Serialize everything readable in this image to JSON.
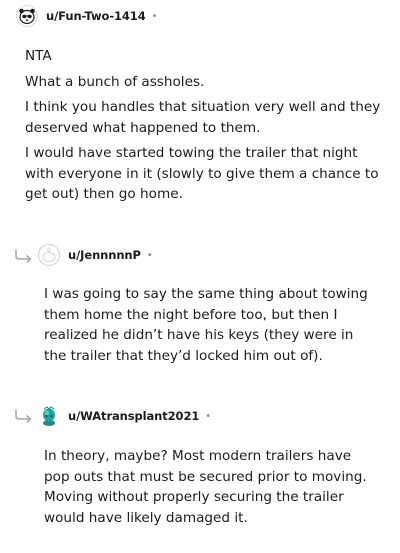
{
  "comments": [
    {
      "username": "u/Fun-Two-1414",
      "separator": "•",
      "avatar_icon": "panda-avatar-icon",
      "paragraphs": [
        "NTA",
        "What a bunch of assholes.",
        "I think you handles that situation very well and they deserved what happened to them.",
        "I would have started towing the trailer that night with everyone in it (slowly to give them a chance to get out) then go home."
      ]
    },
    {
      "username": "u/JennnnnP",
      "separator": "•",
      "avatar_icon": "default-snoo-avatar-icon",
      "reply_icon": "reply-arrow-icon",
      "paragraphs": [
        "I was going to say the same thing about towing them home the night before too, but then I realized he didn’t have his keys (they were in the trailer that they’d locked him out of)."
      ]
    },
    {
      "username": "u/WAtransplant2021",
      "separator": "•",
      "avatar_icon": "teal-snoo-avatar-icon",
      "reply_icon": "reply-arrow-icon",
      "paragraphs": [
        "In theory, maybe? Most modern trailers have pop outs that must be secured prior to moving. Moving without properly securing the trailer would have likely damaged it."
      ]
    }
  ],
  "colors": {
    "text": "#1c1c1c",
    "meta": "#878a8c",
    "reply_arrow": "#a8aaab",
    "teal_avatar": "#24a0a0"
  }
}
